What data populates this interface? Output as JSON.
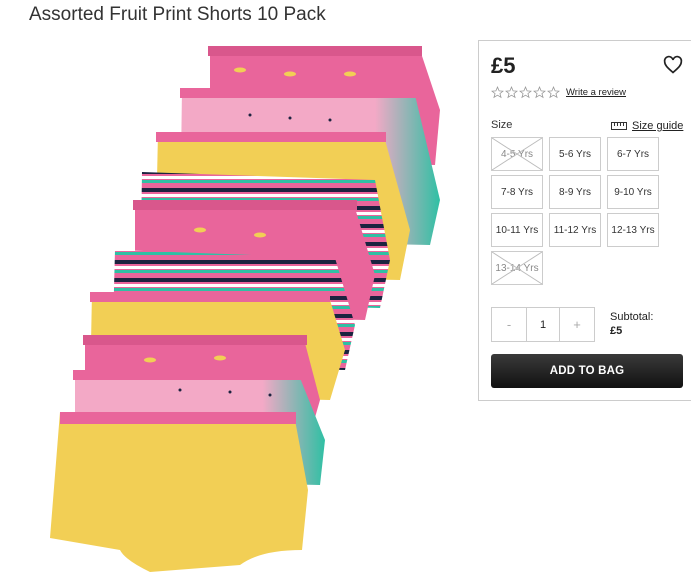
{
  "product": {
    "title": "Assorted Fruit Print Shorts 10 Pack",
    "price": "£5",
    "write_review": "Write a review",
    "rating_stars": 0,
    "size_label": "Size",
    "size_guide": "Size guide",
    "sizes": [
      {
        "label": "4-5 Yrs",
        "available": false
      },
      {
        "label": "5-6 Yrs",
        "available": true
      },
      {
        "label": "6-7 Yrs",
        "available": true
      },
      {
        "label": "7-8 Yrs",
        "available": true
      },
      {
        "label": "8-9 Yrs",
        "available": true
      },
      {
        "label": "9-10 Yrs",
        "available": true
      },
      {
        "label": "10-11 Yrs",
        "available": true
      },
      {
        "label": "11-12 Yrs",
        "available": true
      },
      {
        "label": "12-13 Yrs",
        "available": true
      },
      {
        "label": "13-14 Yrs",
        "available": false
      }
    ],
    "quantity": {
      "minus": "-",
      "value": "1",
      "plus": "+"
    },
    "subtotal_label": "Subtotal:",
    "subtotal_value": "£5",
    "add_to_bag": "ADD TO BAG"
  },
  "colors": {
    "pink": "#e9659b",
    "light_pink": "#f3a9c6",
    "yellow": "#f2cf55",
    "teal": "#2fc0a4",
    "navy": "#1c2340",
    "button_dark": "#1a1a1a"
  },
  "icons": {
    "wishlist": "heart-outline-icon",
    "star": "star-outline-icon",
    "size_guide": "ruler-icon"
  }
}
